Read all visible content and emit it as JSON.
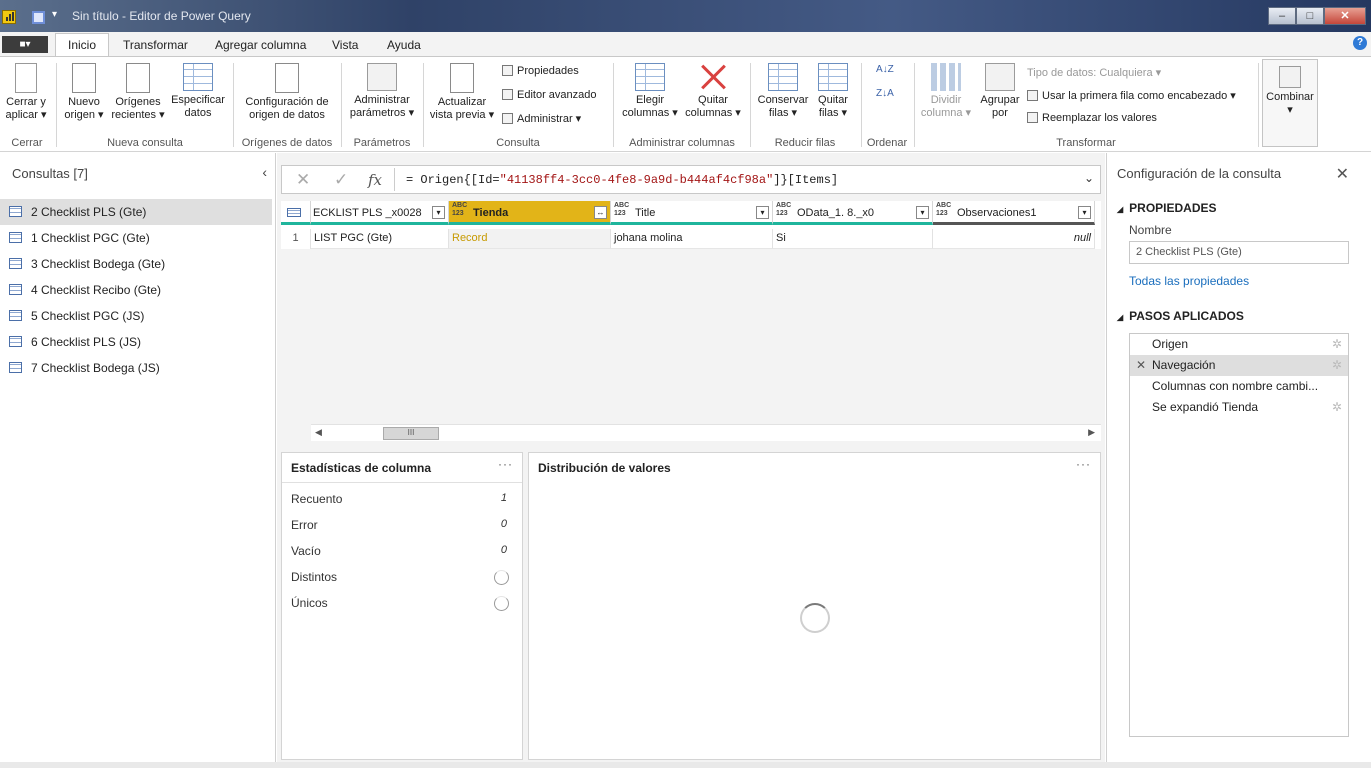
{
  "window": {
    "title": "Sin título - Editor de Power Query",
    "qat_dropdown": "▾",
    "minimize": "–",
    "maximize": "□",
    "close": "✕"
  },
  "menu": {
    "file": "■▾",
    "tabs": [
      "Inicio",
      "Transformar",
      "Agregar columna",
      "Vista",
      "Ayuda"
    ],
    "help": "?"
  },
  "ribbon": {
    "cerrar_aplicar": [
      "Cerrar y",
      "aplicar ▾"
    ],
    "nuevo_origen": [
      "Nuevo",
      "origen ▾"
    ],
    "origenes_recientes": [
      "Orígenes",
      "recientes ▾"
    ],
    "especificar_datos": [
      "Especificar",
      "datos"
    ],
    "config_origen": [
      "Configuración de",
      "origen de datos"
    ],
    "admin_parametros": [
      "Administrar",
      "parámetros ▾"
    ],
    "actualizar": [
      "Actualizar",
      "vista previa ▾"
    ],
    "propiedades": "Propiedades",
    "editor_avanzado": "Editor avanzado",
    "administrar": "Administrar ▾",
    "elegir_columnas": [
      "Elegir",
      "columnas ▾"
    ],
    "quitar_columnas": [
      "Quitar",
      "columnas ▾"
    ],
    "conservar_filas": [
      "Conservar",
      "filas ▾"
    ],
    "quitar_filas": [
      "Quitar",
      "filas ▾"
    ],
    "sort_asc": "A↓Z",
    "sort_desc": "Z↓A",
    "dividir_columna": [
      "Dividir",
      "columna ▾"
    ],
    "agrupar_por": [
      "Agrupar",
      "por"
    ],
    "tipo_datos": "Tipo de datos: Cualquiera ▾",
    "primera_fila": "Usar la primera fila como encabezado ▾",
    "reemplazar": "Reemplazar los valores",
    "combinar": "Combinar",
    "combinar_caret": "▾",
    "groups": {
      "cerrar": "Cerrar",
      "nueva_consulta": "Nueva consulta",
      "origenes": "Orígenes de datos",
      "parametros": "Parámetros",
      "consulta": "Consulta",
      "admin_columnas": "Administrar columnas",
      "reducir_filas": "Reducir filas",
      "ordenar": "Ordenar",
      "transformar": "Transformar"
    }
  },
  "queries": {
    "title": "Consultas [7]",
    "collapse": "‹",
    "items": [
      {
        "label": "2 Checklist PLS (Gte)"
      },
      {
        "label": "1 Checklist PGC (Gte)"
      },
      {
        "label": "3 Checklist Bodega (Gte)"
      },
      {
        "label": "4 Checklist Recibo (Gte)"
      },
      {
        "label": "5 Checklist PGC (JS)"
      },
      {
        "label": "6 Checklist PLS (JS)"
      },
      {
        "label": "7 Checklist Bodega (JS)"
      }
    ]
  },
  "formula": {
    "cancel": "✕",
    "commit": "✓",
    "fx": "fx",
    "prefix": "= Origen{[Id=",
    "id_string": "\"41138ff4-3cc0-4fe8-9a9d-b444af4cf98a\"",
    "suffix": "]}[Items]",
    "expand": "⌄"
  },
  "grid": {
    "type_glyph": "ABC\n123",
    "columns": [
      {
        "name": "ECKLIST PLS _x0028"
      },
      {
        "name": "Tienda"
      },
      {
        "name": "Title"
      },
      {
        "name": "OData_1. 8._x0"
      },
      {
        "name": "Observaciones1"
      }
    ],
    "row_number": "1",
    "row": [
      "LIST PGC (Gte)",
      "Record",
      "johana molina",
      "Si",
      "null"
    ],
    "scroll_thumb": "III"
  },
  "stats": {
    "title": "Estadísticas de columna",
    "more": "···",
    "rows": [
      {
        "label": "Recuento",
        "value": "1"
      },
      {
        "label": "Error",
        "value": "0"
      },
      {
        "label": "Vacío",
        "value": "0"
      },
      {
        "label": "Distintos"
      },
      {
        "label": "Únicos"
      }
    ]
  },
  "distribution": {
    "title": "Distribución de valores",
    "more": "···"
  },
  "settings": {
    "title": "Configuración de la consulta",
    "close": "✕",
    "properties": "PROPIEDADES",
    "name_label": "Nombre",
    "name_value": "2 Checklist PLS (Gte)",
    "all_properties": "Todas las propiedades",
    "steps_title": "PASOS APLICADOS",
    "steps": [
      {
        "label": "Origen"
      },
      {
        "label": "Navegación"
      },
      {
        "label": "Columnas con nombre cambi..."
      },
      {
        "label": "Se expandió Tienda"
      }
    ]
  },
  "colors": {
    "accent_teal": "#1fb59c",
    "selected_header": "#e2b418",
    "record_text": "#c79a00",
    "link_blue": "#1a6ebd"
  }
}
